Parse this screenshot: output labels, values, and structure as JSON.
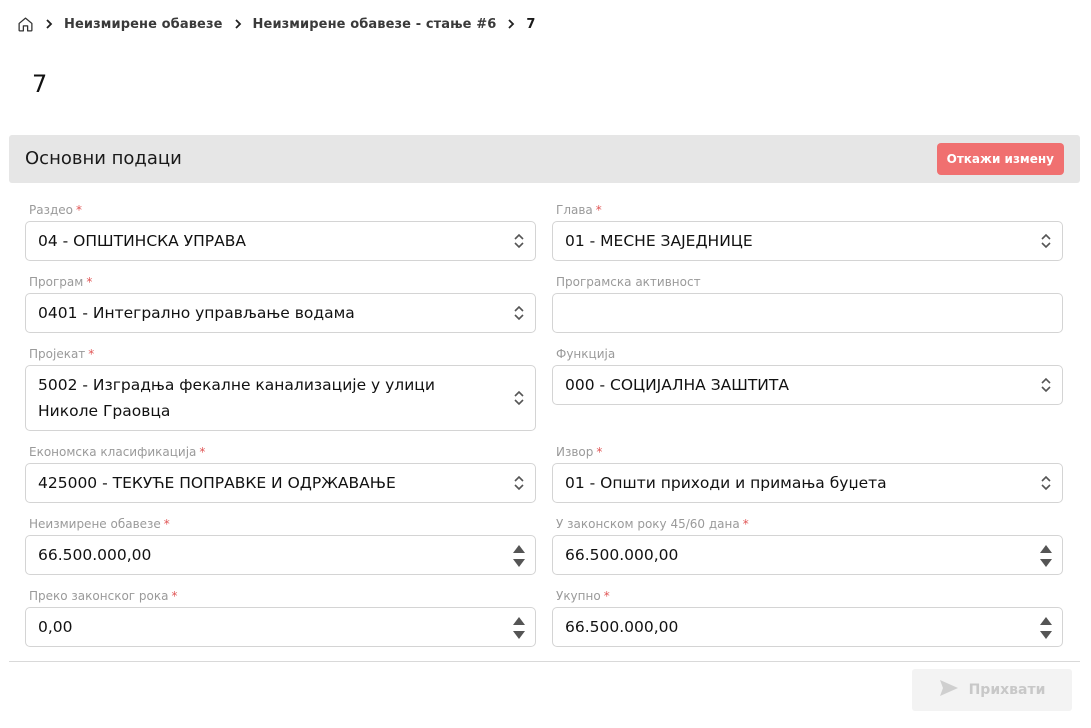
{
  "breadcrumb": {
    "home_icon": "home-icon",
    "items": [
      "Неизмирене обавезе",
      "Неизмирене обавезе - стање #6"
    ],
    "current": "7"
  },
  "page": {
    "title": "7"
  },
  "section": {
    "title": "Основни подаци",
    "cancel_label": "Откажи измену"
  },
  "fields": {
    "razdeo": {
      "label": "Раздео",
      "value": "04 - ОПШТИНСКА УПРАВА"
    },
    "glava": {
      "label": "Глава",
      "value": "01 - МЕСНЕ ЗАЈЕДНИЦЕ"
    },
    "program": {
      "label": "Програм",
      "value": "0401 - Интегрално управљање водама"
    },
    "programska": {
      "label": "Програмска активност",
      "value": ""
    },
    "projekat": {
      "label": "Пројекат",
      "value": "5002 - Изградња фекалне канализације у улици Николе Граовца"
    },
    "funkcija": {
      "label": "Функција",
      "value": "000 - СОЦИЈАЛНА ЗАШТИТА"
    },
    "ekonomska": {
      "label": "Економска класификација",
      "value": "425000 - ТЕКУЋЕ ПОПРАВКЕ И ОДРЖАВАЊЕ"
    },
    "izvor": {
      "label": "Извор",
      "value": "01 - Општи приходи и примања буџета"
    },
    "neizmirene": {
      "label": "Неизмирене обавезе",
      "value": "66.500.000,00"
    },
    "u_roku": {
      "label": "У законском року 45/60 дана",
      "value": "66.500.000,00"
    },
    "preko_roka": {
      "label": "Преко законског рока",
      "value": "0,00"
    },
    "ukupno": {
      "label": "Укупно",
      "value": "66.500.000,00"
    }
  },
  "required_mark": "*",
  "footer": {
    "accept_label": "Прихвати"
  },
  "colors": {
    "cancel": "#f07070",
    "required": "#e05555",
    "header_bg": "#e6e6e6"
  }
}
